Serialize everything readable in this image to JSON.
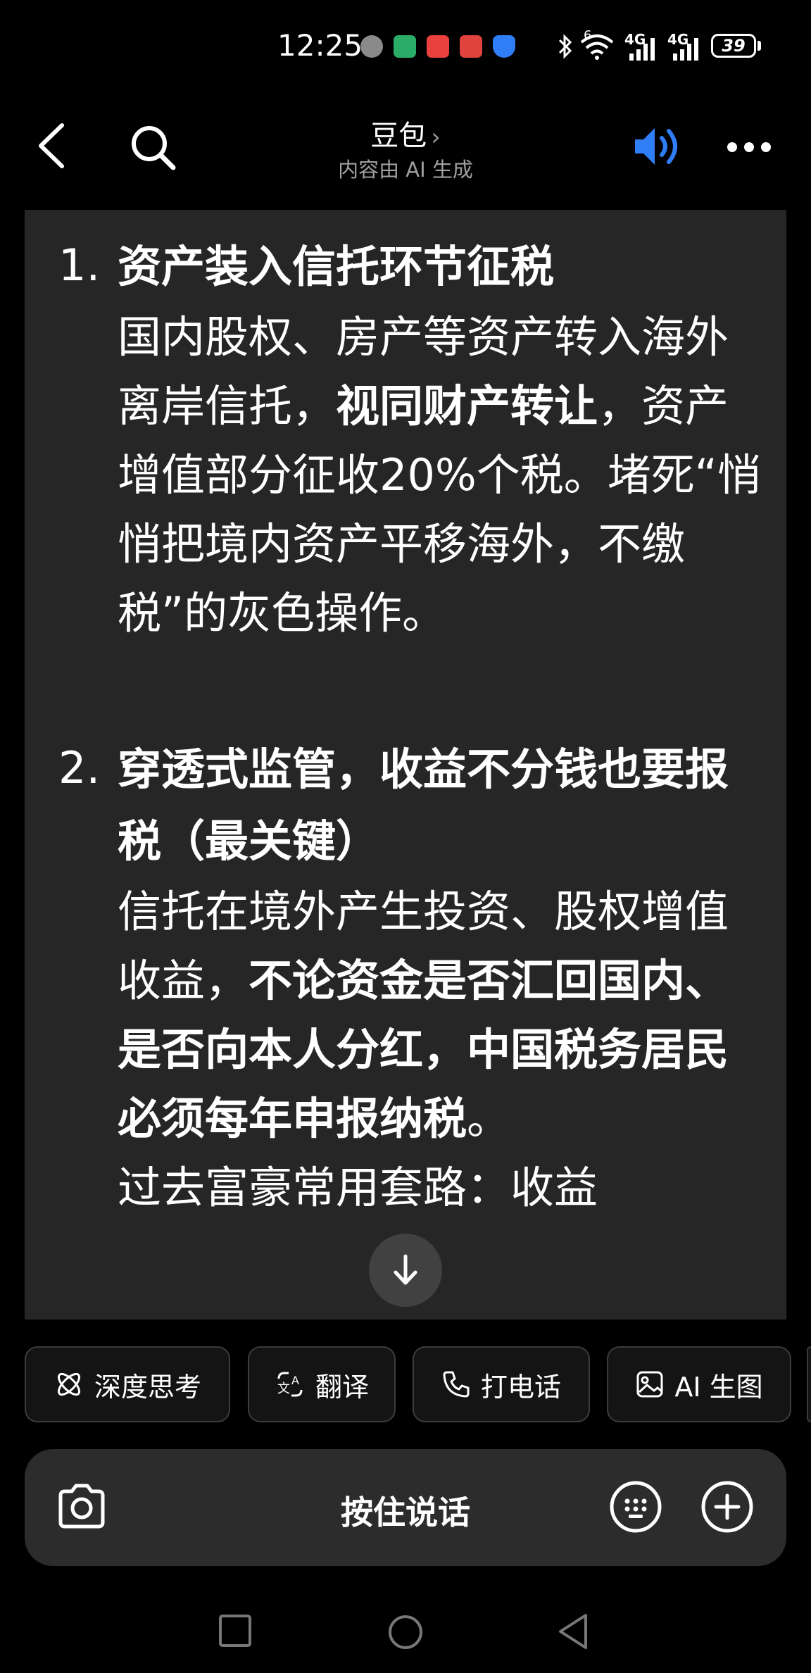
{
  "status_bar": {
    "time": "12:25",
    "battery": "39",
    "network_1": "4G",
    "network_2": "4G",
    "wifi_badge": "6",
    "notification_icons": [
      "avatar-notification-icon",
      "wechat-icon",
      "toutiao-icon",
      "book-app-icon",
      "shield-app-icon"
    ],
    "colors": {
      "wechat": "#2aae67",
      "toutiao": "#e8413e",
      "book": "#e0433d",
      "shield": "#2f7ef6"
    }
  },
  "header": {
    "title": "豆包",
    "title_chevron": "›",
    "subtitle": "内容由 AI 生成"
  },
  "content": {
    "items": [
      {
        "number": "1.",
        "heading": "资产装入信托环节征税",
        "text_1": "国内股权、房产等资产转入海外离岸信托，",
        "bold_1": "视同财产转让",
        "text_2": "，资产增值部分征收20%个税。堵死“悄悄把境内资产平移海外，不缴税”的灰色操作。"
      },
      {
        "number": "2.",
        "heading": "穿透式监管，收益不分钱也要报税（最关键）",
        "text_1": "信托在境外产生投资、股权增值收益，",
        "bold_1": "不论资金是否汇回国内、是否向本人分红，中国税务居民必须每年申报纳税",
        "text_2": "。",
        "text_3": "过去富豪常用套路：收益"
      }
    ]
  },
  "chips": [
    {
      "label": "深度思考",
      "icon": "atom-icon"
    },
    {
      "label": "翻译",
      "icon": "translate-icon"
    },
    {
      "label": "打电话",
      "icon": "phone-icon"
    },
    {
      "label": "AI 生图",
      "icon": "image-icon"
    }
  ],
  "input_bar": {
    "label": "按住说话"
  },
  "colors": {
    "accent_speaker": "#2f7ef6",
    "card_bg": "#262626",
    "page_bg": "#000000"
  }
}
